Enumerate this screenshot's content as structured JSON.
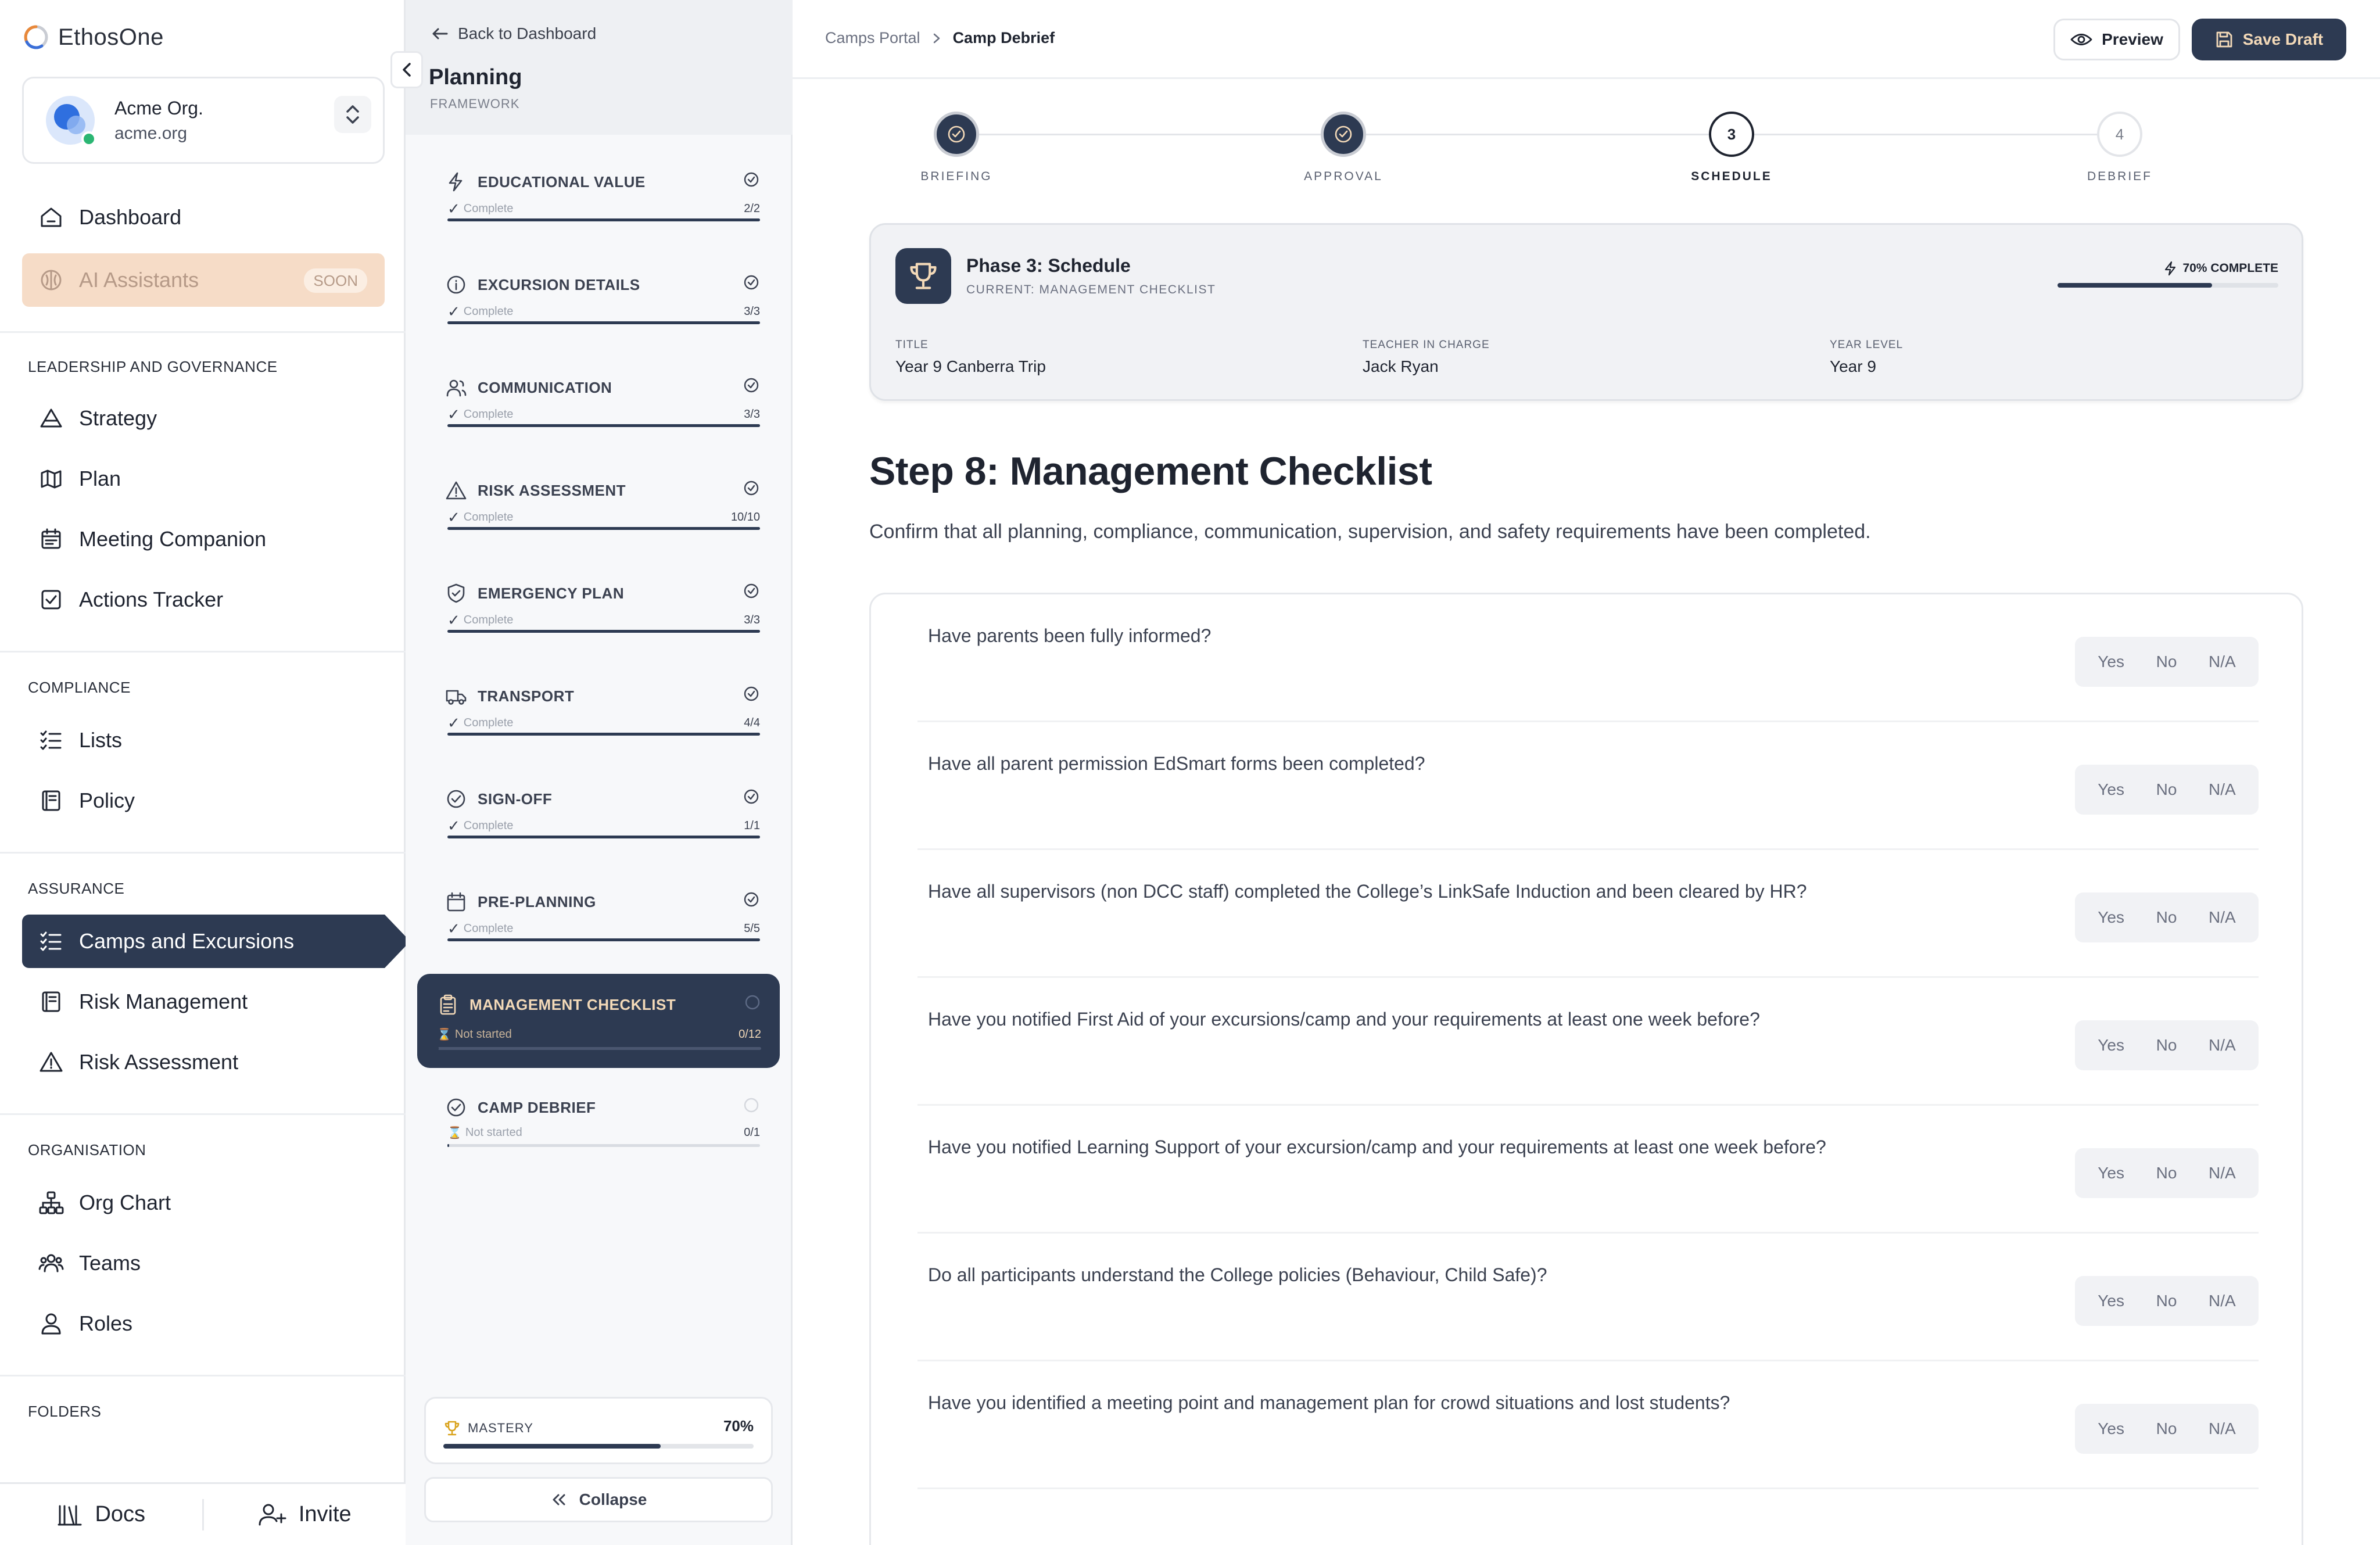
{
  "brand": {
    "name": "EthosOne"
  },
  "org": {
    "name": "Acme Org.",
    "domain": "acme.org"
  },
  "nav": {
    "dashboard": "Dashboard",
    "ai_assistants": "AI Assistants",
    "soon_badge": "SOON",
    "sections": {
      "leadership": "LEADERSHIP AND GOVERNANCE",
      "compliance": "COMPLIANCE",
      "assurance": "ASSURANCE",
      "organisation": "ORGANISATION",
      "folders": "FOLDERS"
    },
    "leadership_items": [
      "Strategy",
      "Plan",
      "Meeting Companion",
      "Actions Tracker"
    ],
    "compliance_items": [
      "Lists",
      "Policy"
    ],
    "assurance_items": [
      "Camps and Excursions",
      "Risk Management",
      "Risk Assessment"
    ],
    "organisation_items": [
      "Org Chart",
      "Teams",
      "Roles"
    ]
  },
  "footer": {
    "docs": "Docs",
    "invite": "Invite"
  },
  "planning": {
    "back": "Back to Dashboard",
    "title": "Planning",
    "subtitle": "FRAMEWORK",
    "steps": [
      {
        "title": "EDUCATIONAL VALUE",
        "status": "Complete",
        "count": "2/2",
        "progress": 1.0,
        "icon": "zap-icon"
      },
      {
        "title": "EXCURSION DETAILS",
        "status": "Complete",
        "count": "3/3",
        "progress": 1.0,
        "icon": "info-icon"
      },
      {
        "title": "COMMUNICATION",
        "status": "Complete",
        "count": "3/3",
        "progress": 1.0,
        "icon": "users-icon"
      },
      {
        "title": "RISK ASSESSMENT",
        "status": "Complete",
        "count": "10/10",
        "progress": 1.0,
        "icon": "warning-icon"
      },
      {
        "title": "EMERGENCY PLAN",
        "status": "Complete",
        "count": "3/3",
        "progress": 1.0,
        "icon": "shield-icon"
      },
      {
        "title": "TRANSPORT",
        "status": "Complete",
        "count": "4/4",
        "progress": 1.0,
        "icon": "truck-icon"
      },
      {
        "title": "SIGN-OFF",
        "status": "Complete",
        "count": "1/1",
        "progress": 1.0,
        "icon": "check-circle-icon"
      },
      {
        "title": "PRE-PLANNING",
        "status": "Complete",
        "count": "5/5",
        "progress": 1.0,
        "icon": "calendar-icon"
      },
      {
        "title": "MANAGEMENT CHECKLIST",
        "status": "Not started",
        "count": "0/12",
        "progress": 0,
        "icon": "clipboard-icon"
      },
      {
        "title": "CAMP DEBRIEF",
        "status": "Not started",
        "count": "0/1",
        "progress": 0,
        "icon": "check-circle-icon"
      }
    ],
    "mastery_label": "MASTERY",
    "mastery_value": "70%",
    "mastery_progress": 0.7,
    "collapse": "Collapse"
  },
  "topbar": {
    "breadcrumb": [
      "Camps Portal",
      "Camp Debrief"
    ],
    "preview": "Preview",
    "save_draft": "Save Draft"
  },
  "stepper": [
    {
      "label": "BRIEFING",
      "state": "done",
      "num": ""
    },
    {
      "label": "APPROVAL",
      "state": "done",
      "num": ""
    },
    {
      "label": "SCHEDULE",
      "state": "current",
      "num": "3"
    },
    {
      "label": "DEBRIEF",
      "state": "todo",
      "num": "4"
    }
  ],
  "phase": {
    "title": "Phase 3: Schedule",
    "current": "CURRENT: MANAGEMENT CHECKLIST",
    "complete": "70% COMPLETE",
    "progress": 0.7,
    "meta": [
      {
        "key": "TITLE",
        "value": "Year 9 Canberra Trip"
      },
      {
        "key": "TEACHER IN CHARGE",
        "value": "Jack Ryan"
      },
      {
        "key": "YEAR LEVEL",
        "value": "Year 9"
      }
    ]
  },
  "step": {
    "heading": "Step 8: Management Checklist",
    "description": "Confirm that all planning, compliance, communication, supervision, and safety requirements have been completed."
  },
  "answer_options": [
    "Yes",
    "No",
    "N/A"
  ],
  "questions": [
    "Have parents been fully informed?",
    "Have all parent permission EdSmart forms been completed?",
    "Have all supervisors (non DCC staff) completed the College’s LinkSafe Induction and been cleared by HR?",
    "Have you notified First Aid of your excursions/camp and your requirements at least one week before?",
    "Have you notified Learning Support of your excursion/camp and your requirements at least one week before?",
    "Do all participants understand the College policies (Behaviour, Child Safe)?",
    "Have you identified a meeting point and management plan for crowd situations and lost students?"
  ],
  "colors": {
    "navy": "#2d3a52",
    "peach": "#f6dcc7",
    "accent_text": "#f3d9b8"
  }
}
